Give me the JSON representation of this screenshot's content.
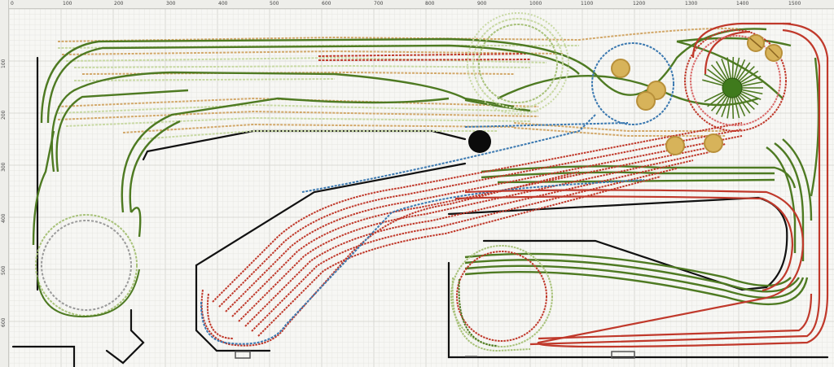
{
  "ruler": {
    "top_labels": [
      "0",
      "100",
      "200",
      "300",
      "400",
      "500",
      "600",
      "700",
      "800",
      "900",
      "1000",
      "1100",
      "1200",
      "1300",
      "1400",
      "1500"
    ],
    "left_labels": [
      "100",
      "200",
      "300",
      "400",
      "500",
      "600"
    ]
  },
  "colors": {
    "background": "#f7f7f4",
    "grid_minor": "#e6e6e2",
    "grid_major": "#d2d2cd",
    "track_dark_green": "#4e7a22",
    "track_light_green": "#a8c27a",
    "track_pale_green": "#c8d9a4",
    "track_red": "#c0392b",
    "track_tan": "#d2a86a",
    "track_blue": "#3a78b0",
    "wall": "#111111",
    "turntable_gold": "#b8903a",
    "turntable_fill": "#d7b35a"
  },
  "canvas": {
    "legend_items": []
  }
}
